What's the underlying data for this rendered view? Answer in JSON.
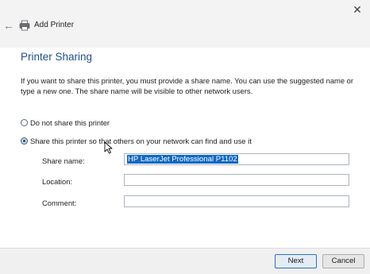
{
  "window": {
    "title": "Add Printer",
    "close_glyph": "✕",
    "back_glyph": "←"
  },
  "page": {
    "heading": "Printer Sharing",
    "intro": "If you want to share this printer, you must provide a share name. You can use the suggested name or type a new one. The share name will be visible to other network users."
  },
  "options": {
    "do_not_share": {
      "label": "Do not share this printer",
      "selected": false
    },
    "share": {
      "label": "Share this printer so that others on your network can find and use it",
      "selected": true
    }
  },
  "fields": {
    "share_name": {
      "label": "Share name:",
      "value": "HP LaserJet Professional P1102"
    },
    "location": {
      "label": "Location:",
      "value": ""
    },
    "comment": {
      "label": "Comment:",
      "value": ""
    }
  },
  "buttons": {
    "next": "Next",
    "cancel": "Cancel"
  },
  "icons": {
    "printer": "printer-icon",
    "back": "back-arrow-icon",
    "close": "close-icon",
    "cursor": "mouse-cursor-icon"
  },
  "colors": {
    "heading": "#1e4e8c",
    "selection": "#0d68c4",
    "primary_border": "#2a6fc9"
  }
}
